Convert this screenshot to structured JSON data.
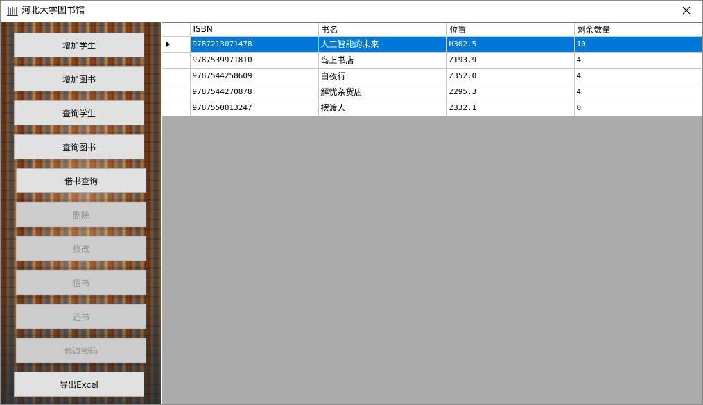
{
  "window": {
    "title": "河北大学图书馆"
  },
  "sidebar": {
    "buttons": [
      {
        "label": "增加学生",
        "enabled": true
      },
      {
        "label": "增加图书",
        "enabled": true
      },
      {
        "label": "查询学生",
        "enabled": true
      },
      {
        "label": "查询图书",
        "enabled": true
      },
      {
        "label": "借书查询",
        "enabled": true
      },
      {
        "label": "删除",
        "enabled": false
      },
      {
        "label": "修改",
        "enabled": false
      },
      {
        "label": "借书",
        "enabled": false
      },
      {
        "label": "还书",
        "enabled": false
      },
      {
        "label": "修改密码",
        "enabled": false
      },
      {
        "label": "导出Excel",
        "enabled": true
      }
    ]
  },
  "grid": {
    "columns": [
      "ISBN",
      "书名",
      "位置",
      "剩余数量"
    ],
    "rows": [
      {
        "isbn": "9787213071478",
        "title": "人工智能的未来",
        "location": "H302.5",
        "remaining": "10"
      },
      {
        "isbn": "9787539971810",
        "title": "岛上书店",
        "location": "Z193.9",
        "remaining": "4"
      },
      {
        "isbn": "9787544258609",
        "title": "白夜行",
        "location": "Z352.0",
        "remaining": "4"
      },
      {
        "isbn": "9787544270878",
        "title": "解忧杂货店",
        "location": "Z295.3",
        "remaining": "4"
      },
      {
        "isbn": "9787550013247",
        "title": "摆渡人",
        "location": "Z332.1",
        "remaining": "0"
      }
    ],
    "selected_row": 0
  },
  "icons": {
    "app": "library-books-icon",
    "close": "close-icon",
    "row_indicator": "row-selector-arrow-icon"
  },
  "colors": {
    "selection": "#0078d7",
    "grid_background": "#ababab",
    "button": "#e1e1e1",
    "disabled_button": "#cccccc"
  }
}
